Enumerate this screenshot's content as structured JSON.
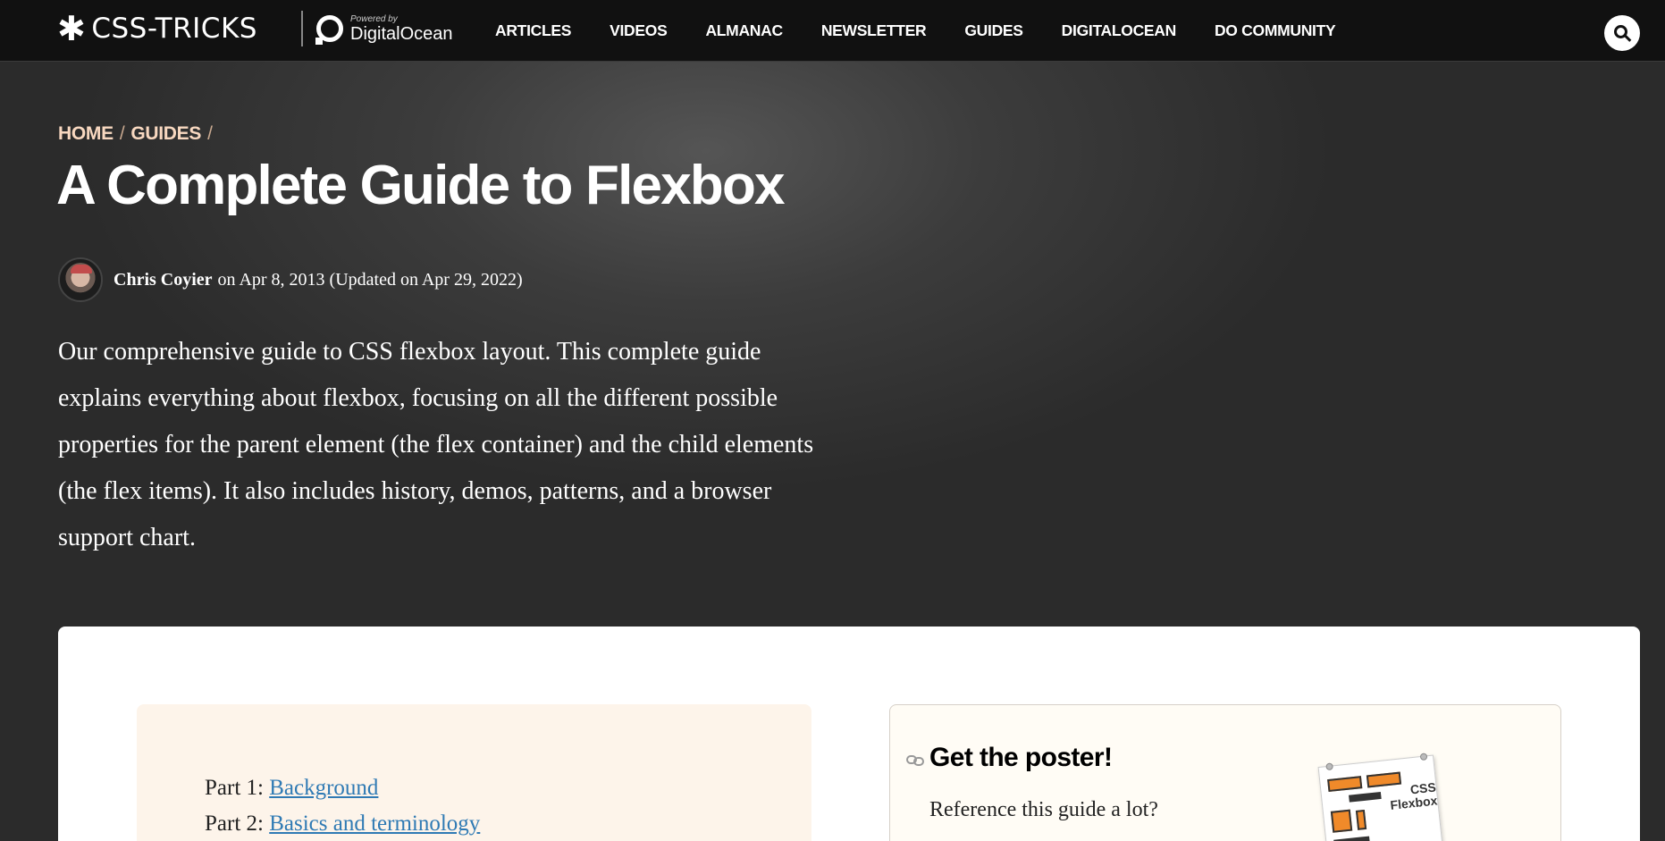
{
  "header": {
    "logo": "CSS-TRICKS",
    "logo_glyph": "✱",
    "powered_by": "Powered by",
    "sponsor": "DigitalOcean",
    "nav": [
      "ARTICLES",
      "VIDEOS",
      "ALMANAC",
      "NEWSLETTER",
      "GUIDES",
      "DIGITALOCEAN",
      "DO COMMUNITY"
    ],
    "search_icon": "search-icon"
  },
  "breadcrumb": {
    "items": [
      "HOME",
      "GUIDES"
    ],
    "separator": "/"
  },
  "article": {
    "title": "A Complete Guide to Flexbox",
    "author": "Chris Coyier",
    "meta": "on Apr 8, 2013 (Updated on Apr 29, 2022)",
    "intro": "Our comprehensive guide to CSS flexbox layout. This complete guide explains everything about flexbox, focusing on all the different possible properties for the parent element (the flex container) and the child elements (the flex items). It also includes history, demos, patterns, and a browser support chart."
  },
  "toc": {
    "items": [
      {
        "prefix": "Part 1:",
        "label": "Background"
      },
      {
        "prefix": "Part 2:",
        "label": "Basics and terminology"
      }
    ]
  },
  "poster": {
    "title": "Get the poster!",
    "text": "Reference this guide a lot?",
    "thumb_label": "CSS Flexbox",
    "link_icon": "link-icon"
  },
  "colors": {
    "breadcrumb": "#f8d8c0",
    "link": "#2f7ab4",
    "toc_bg": "#fdf4ea"
  }
}
